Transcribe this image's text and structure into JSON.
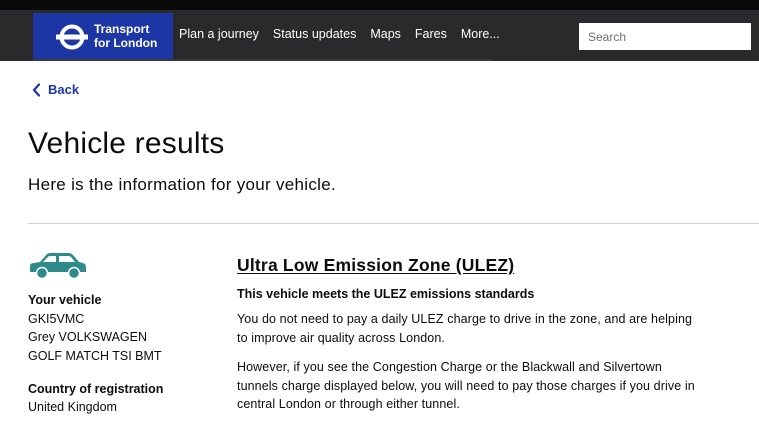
{
  "brand": {
    "line1": "Transport",
    "line2": "for London"
  },
  "nav": {
    "items": [
      "Plan a journey",
      "Status updates",
      "Maps",
      "Fares",
      "More..."
    ]
  },
  "search": {
    "placeholder": "Search"
  },
  "back_label": "Back",
  "page": {
    "title": "Vehicle results",
    "subtitle": "Here is the information for your vehicle."
  },
  "vehicle": {
    "icon": "car-icon",
    "icon_color": "#2f8a8c",
    "label": "Your vehicle",
    "registration": "GKI5VMC",
    "make": "Grey VOLKSWAGEN",
    "model": "GOLF MATCH TSI BMT"
  },
  "country": {
    "label": "Country of registration",
    "value": "United Kingdom"
  },
  "ulez": {
    "heading": "Ultra Low Emission Zone (ULEZ)",
    "status": "This vehicle meets the ULEZ emissions standards",
    "para1": "You do not need to pay a daily ULEZ charge to drive in the zone, and are helping to improve air quality across London.",
    "para2": "However, if you see the Congestion Charge or the Blackwall and Silvertown tunnels charge displayed below, you will need to pay those charges if you drive in central London or through either tunnel."
  },
  "colors": {
    "nav_bg": "#2a2a2d",
    "brand_bg": "#1c36a6",
    "link": "#1c36a6",
    "text": "#0b0c0c"
  }
}
